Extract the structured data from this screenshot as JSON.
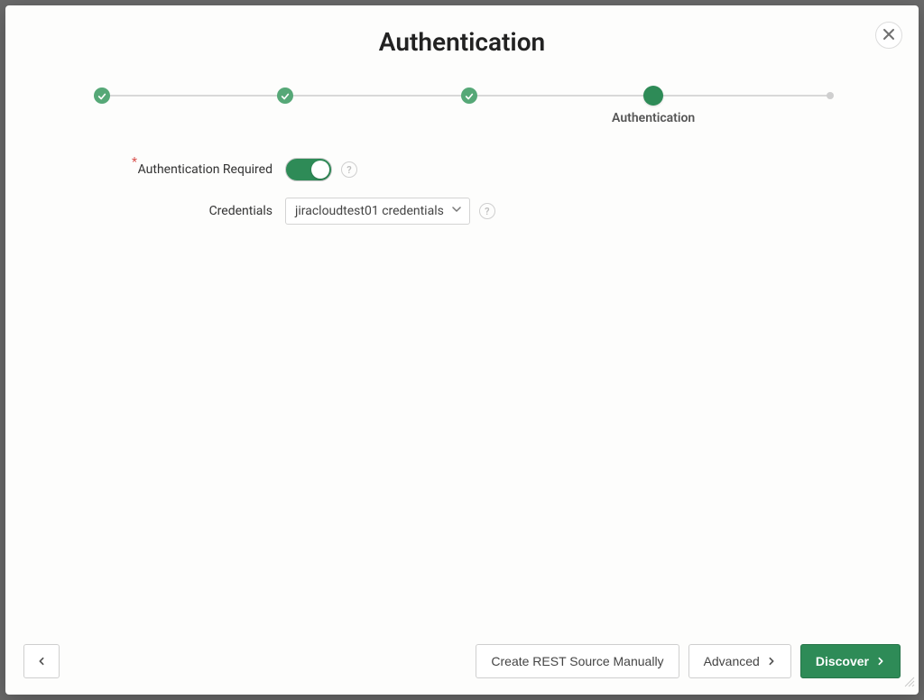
{
  "modal": {
    "title": "Authentication"
  },
  "stepper": {
    "current_label": "Authentication"
  },
  "form": {
    "auth_required": {
      "label": "Authentication Required",
      "required_mark": "*",
      "value": true
    },
    "credentials": {
      "label": "Credentials",
      "selected": "jiracloudtest01 credentials"
    },
    "help_glyph": "?"
  },
  "footer": {
    "create_manual": "Create REST Source Manually",
    "advanced": "Advanced",
    "discover": "Discover"
  }
}
